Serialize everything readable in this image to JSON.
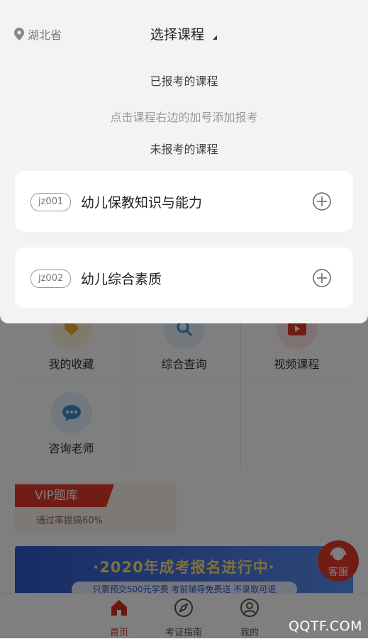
{
  "header": {
    "location": "湖北省",
    "select_title": "选择课程"
  },
  "sections": {
    "enrolled": "已报考的课程",
    "hint": "点击课程右边的加号添加报考",
    "not_enrolled": "未报考的课程"
  },
  "courses": [
    {
      "code": "jz001",
      "name": "幼儿保教知识与能力"
    },
    {
      "code": "jz002",
      "name": "幼儿综合素质"
    }
  ],
  "grid": [
    "我的收藏",
    "综合查询",
    "视频课程",
    "咨询老师"
  ],
  "vip": {
    "tag": "VIP题库",
    "subtitle": "通过率提搞60%"
  },
  "banner": {
    "title": "·2020年成考报名进行中·",
    "subtitle": "只需预交500元学费 考前辅导免费送 不录取可退"
  },
  "service": "客服",
  "tabs": [
    "首页",
    "考证指南",
    "我的"
  ],
  "watermark": "QQTF.COM",
  "colors": {
    "accent": "#d93025",
    "panel_bg": "#f3f3f3",
    "banner": "#2f59c9"
  }
}
